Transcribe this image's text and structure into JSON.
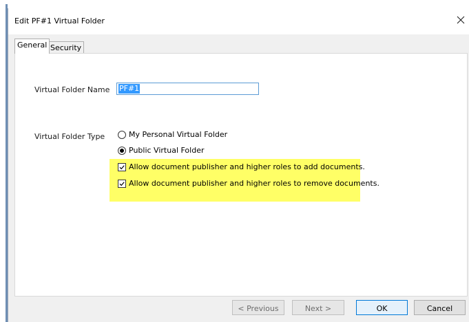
{
  "window": {
    "title": "Edit PF#1 Virtual Folder",
    "close_label": "×"
  },
  "tabs": [
    {
      "label": "General",
      "active": true
    },
    {
      "label": "Security",
      "active": false
    }
  ],
  "general": {
    "name_label": "Virtual Folder Name",
    "name_value": "PF#1",
    "type_label": "Virtual Folder Type",
    "options": [
      {
        "label": "My Personal Virtual Folder",
        "selected": false
      },
      {
        "label": "Public Virtual Folder",
        "selected": true
      }
    ],
    "permissions": [
      {
        "label": "Allow document publisher and higher roles to add documents.",
        "checked": true
      },
      {
        "label": "Allow document publisher and higher roles to remove documents.",
        "checked": true
      }
    ],
    "highlight_color": "#ffff66"
  },
  "buttons": {
    "previous": "< Previous",
    "next": "Next >",
    "ok": "OK",
    "cancel": "Cancel"
  },
  "colors": {
    "accent": "#0078d7",
    "selection": "#3399ff"
  }
}
